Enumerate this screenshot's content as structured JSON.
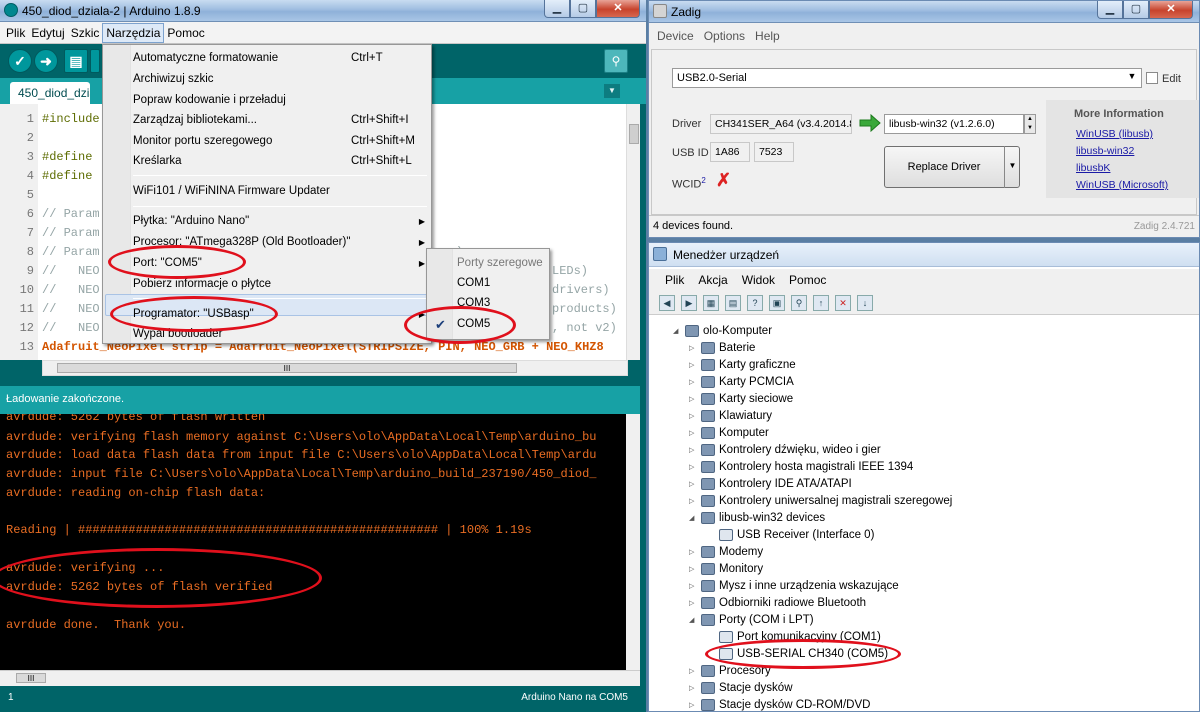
{
  "arduino": {
    "title": "450_diod_dziala-2 | Arduino 1.8.9",
    "menu": [
      "Plik",
      "Edytuj",
      "Szkic",
      "Narzędzia",
      "Pomoc"
    ],
    "tab": "450_diod_dziala",
    "code_lines": [
      {
        "n": "1",
        "text": "#include"
      },
      {
        "n": "2",
        "text": ""
      },
      {
        "n": "3",
        "text": "#define"
      },
      {
        "n": "4",
        "text": "#define"
      },
      {
        "n": "5",
        "text": ""
      },
      {
        "n": "6",
        "text": "// Param"
      },
      {
        "n": "7",
        "text": "// Param"
      },
      {
        "n": "8",
        "text": "// Param"
      },
      {
        "n": "9",
        "text": "//   NEO"
      },
      {
        "n": "10",
        "text": "//   NEO"
      },
      {
        "n": "11",
        "text": "//   NEO"
      },
      {
        "n": "12",
        "text": "//   NEO"
      },
      {
        "n": "13",
        "text": "Adafruit_NeoPixel strip = Adafruit_NeoPixel(STRIPSIZE, PIN, NEO_GRB + NEO_KHZ8"
      }
    ],
    "code_tails": {
      "l8": "):",
      "l9": "LEDs)",
      "l10": "drivers)",
      "l11": "products)",
      "l12": ", not v2)"
    },
    "status_message": "Ładowanie zakończone.",
    "console_lines": [
      "avrdude: 5262 bytes of flash written",
      "avrdude: verifying flash memory against C:\\Users\\olo\\AppData\\Local\\Temp\\arduino_bu",
      "avrdude: load data flash data from input file C:\\Users\\olo\\AppData\\Local\\Temp\\ardu",
      "avrdude: input file C:\\Users\\olo\\AppData\\Local\\Temp\\arduino_build_237190/450_diod_",
      "avrdude: reading on-chip flash data:",
      "",
      "Reading | ################################################## | 100% 1.19s",
      "",
      "avrdude: verifying ...",
      "avrdude: 5262 bytes of flash verified",
      "",
      "avrdude done.  Thank you."
    ],
    "bottom_left": "1",
    "bottom_right": "Arduino Nano na COM5",
    "tools_menu": {
      "items": [
        {
          "label": "Automatyczne formatowanie",
          "shortcut": "Ctrl+T"
        },
        {
          "label": "Archiwizuj szkic",
          "shortcut": ""
        },
        {
          "label": "Popraw kodowanie i przeładuj",
          "shortcut": ""
        },
        {
          "label": "Zarządzaj bibliotekami...",
          "shortcut": "Ctrl+Shift+I"
        },
        {
          "label": "Monitor portu szeregowego",
          "shortcut": "Ctrl+Shift+M"
        },
        {
          "label": "Kreślarka",
          "shortcut": "Ctrl+Shift+L"
        },
        {
          "label": "WiFi101 / WiFiNINA Firmware Updater",
          "shortcut": ""
        },
        {
          "label": "Płytka: \"Arduino Nano\"",
          "shortcut": ""
        },
        {
          "label": "Procesor: \"ATmega328P (Old Bootloader)\"",
          "shortcut": ""
        },
        {
          "label": "Port: \"COM5\"",
          "shortcut": ""
        },
        {
          "label": "Pobierz informacje o płytce",
          "shortcut": ""
        },
        {
          "label": "Programator: \"USBasp\"",
          "shortcut": ""
        },
        {
          "label": "Wypal bootloader",
          "shortcut": ""
        }
      ]
    },
    "port_submenu": {
      "header": "Porty szeregowe",
      "items": [
        "COM1",
        "COM3",
        "COM5"
      ],
      "selected": "COM5"
    }
  },
  "zadig": {
    "title": "Zadig",
    "menu": [
      "Device",
      "Options",
      "Help"
    ],
    "device": "USB2.0-Serial",
    "edit_label": "Edit",
    "driver_label": "Driver",
    "driver_current": "CH341SER_A64 (v3.4.2014.8",
    "driver_target": "libusb-win32 (v1.2.6.0)",
    "usbid_label": "USB ID",
    "usbid_vid": "1A86",
    "usbid_pid": "7523",
    "wcid_label": "WCID",
    "wcid_sup": "2",
    "replace_label": "Replace Driver",
    "more_info_title": "More Information",
    "links": [
      "WinUSB (libusb)",
      "libusb-win32",
      "libusbK",
      "WinUSB (Microsoft)"
    ],
    "status": "4 devices found.",
    "version": "Zadig 2.4.721"
  },
  "devmgr": {
    "title": "Menedżer urządzeń",
    "menu": [
      "Plik",
      "Akcja",
      "Widok",
      "Pomoc"
    ],
    "tree": [
      {
        "label": "olo-Komputer",
        "level": 0,
        "exp": "◢"
      },
      {
        "label": "Baterie",
        "level": 1,
        "exp": "▷"
      },
      {
        "label": "Karty graficzne",
        "level": 1,
        "exp": "▷"
      },
      {
        "label": "Karty PCMCIA",
        "level": 1,
        "exp": "▷"
      },
      {
        "label": "Karty sieciowe",
        "level": 1,
        "exp": "▷"
      },
      {
        "label": "Klawiatury",
        "level": 1,
        "exp": "▷"
      },
      {
        "label": "Komputer",
        "level": 1,
        "exp": "▷"
      },
      {
        "label": "Kontrolery dźwięku, wideo i gier",
        "level": 1,
        "exp": "▷"
      },
      {
        "label": "Kontrolery hosta magistrali IEEE 1394",
        "level": 1,
        "exp": "▷"
      },
      {
        "label": "Kontrolery IDE ATA/ATAPI",
        "level": 1,
        "exp": "▷"
      },
      {
        "label": "Kontrolery uniwersalnej magistrali szeregowej",
        "level": 1,
        "exp": "▷"
      },
      {
        "label": "libusb-win32 devices",
        "level": 1,
        "exp": "◢"
      },
      {
        "label": "USB Receiver (Interface 0)",
        "level": 2,
        "exp": ""
      },
      {
        "label": "Modemy",
        "level": 1,
        "exp": "▷"
      },
      {
        "label": "Monitory",
        "level": 1,
        "exp": "▷"
      },
      {
        "label": "Mysz i inne urządzenia wskazujące",
        "level": 1,
        "exp": "▷"
      },
      {
        "label": "Odbiorniki radiowe Bluetooth",
        "level": 1,
        "exp": "▷"
      },
      {
        "label": "Porty (COM i LPT)",
        "level": 1,
        "exp": "◢"
      },
      {
        "label": "Port komunikacyjny (COM1)",
        "level": 2,
        "exp": ""
      },
      {
        "label": "USB-SERIAL CH340 (COM5)",
        "level": 2,
        "exp": ""
      },
      {
        "label": "Procesory",
        "level": 1,
        "exp": "▷"
      },
      {
        "label": "Stacje dysków",
        "level": 1,
        "exp": "▷"
      },
      {
        "label": "Stacje dysków CD-ROM/DVD",
        "level": 1,
        "exp": "▷"
      }
    ]
  },
  "colors": {
    "arduino_teal": "#006468",
    "console_orange": "#e96d23",
    "annotation_red": "#e0101c"
  }
}
